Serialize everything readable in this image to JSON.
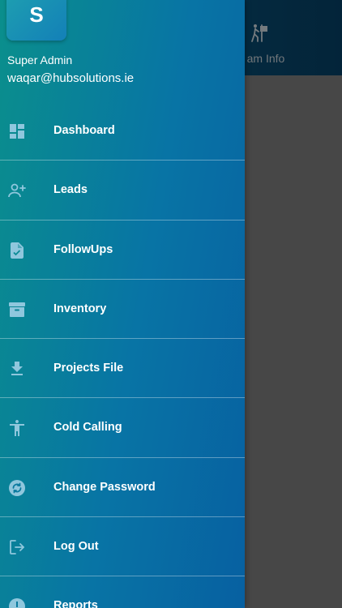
{
  "background": {
    "tab_label": "am Info",
    "tab_icon": "signpost-icon"
  },
  "drawer": {
    "avatar_initial": "S",
    "user_name": "Super Admin",
    "user_email": "waqar@hubsolutions.ie",
    "items": [
      {
        "label": "Dashboard",
        "icon": "dashboard-icon"
      },
      {
        "label": "Leads",
        "icon": "add-person-icon"
      },
      {
        "label": "FollowUps",
        "icon": "document-check-icon"
      },
      {
        "label": "Inventory",
        "icon": "archive-icon"
      },
      {
        "label": "Projects File",
        "icon": "download-icon"
      },
      {
        "label": "Cold Calling",
        "icon": "accessibility-icon"
      },
      {
        "label": "Change Password",
        "icon": "sync-lock-icon"
      },
      {
        "label": "Log Out",
        "icon": "logout-icon"
      },
      {
        "label": "Reports",
        "icon": "info-icon"
      }
    ]
  },
  "colors": {
    "drawer_start": "#0a8f8c",
    "drawer_end": "#0760a1",
    "header_bg": "#0a5e86",
    "icon_color": "#8fc7dd"
  }
}
